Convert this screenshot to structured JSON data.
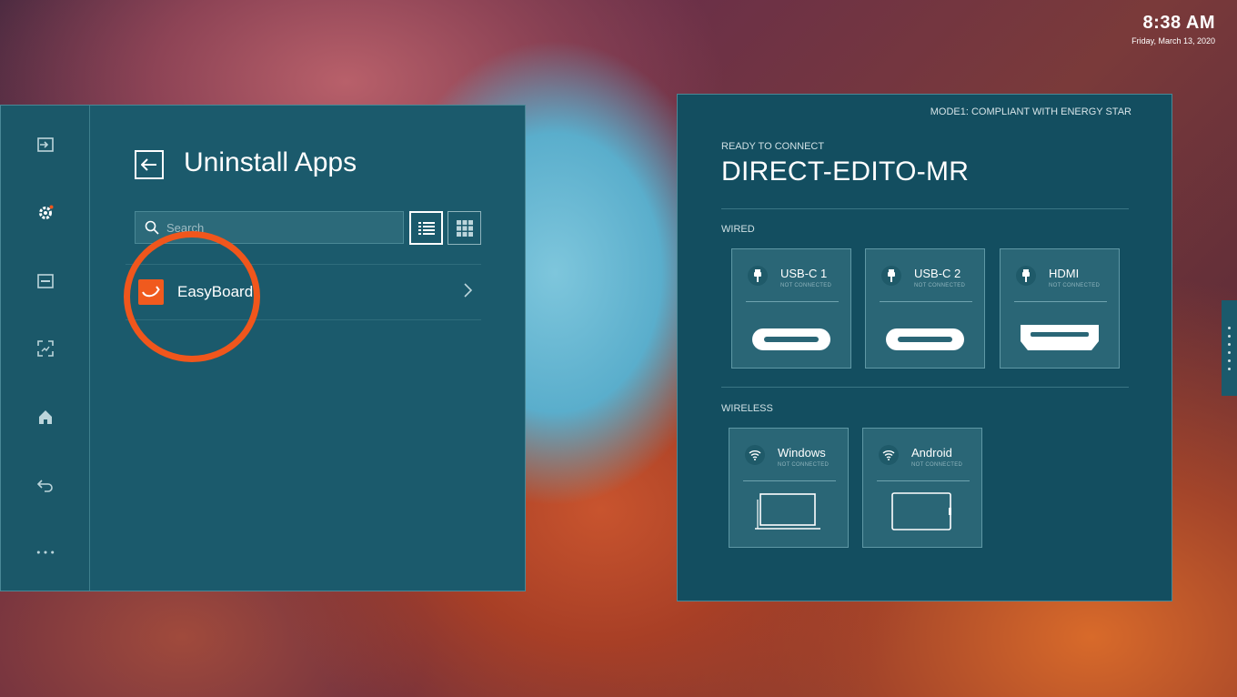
{
  "clock": {
    "time": "8:38 AM",
    "date": "Friday, March 13, 2020"
  },
  "settings": {
    "title": "Uninstall Apps",
    "search_placeholder": "Search",
    "apps": [
      {
        "name": "EasyBoard"
      }
    ]
  },
  "connection": {
    "mode": "MODE1: COMPLIANT WITH ENERGY STAR",
    "ready_label": "READY TO CONNECT",
    "device_name": "DIRECT-EDITO-MR",
    "wired_label": "WIRED",
    "wireless_label": "WIRELESS",
    "wired": [
      {
        "name": "USB-C 1",
        "status": "NOT CONNECTED"
      },
      {
        "name": "USB-C 2",
        "status": "NOT CONNECTED"
      },
      {
        "name": "HDMI",
        "status": "NOT CONNECTED"
      }
    ],
    "wireless": [
      {
        "name": "Windows",
        "status": "NOT CONNECTED"
      },
      {
        "name": "Android",
        "status": "NOT CONNECTED"
      }
    ]
  },
  "colors": {
    "accent": "#f0561c",
    "panel": "#1b5a6c",
    "panel_dark": "#134e60",
    "app_logo": "#f05a1e"
  },
  "icons": [
    "input-icon",
    "gear-icon",
    "display-icon",
    "screenshot-icon",
    "home-icon",
    "back-icon",
    "more-icon",
    "search-icon",
    "list-view-icon",
    "grid-view-icon",
    "chevron-right-icon",
    "usb-plug-icon",
    "wifi-icon"
  ]
}
